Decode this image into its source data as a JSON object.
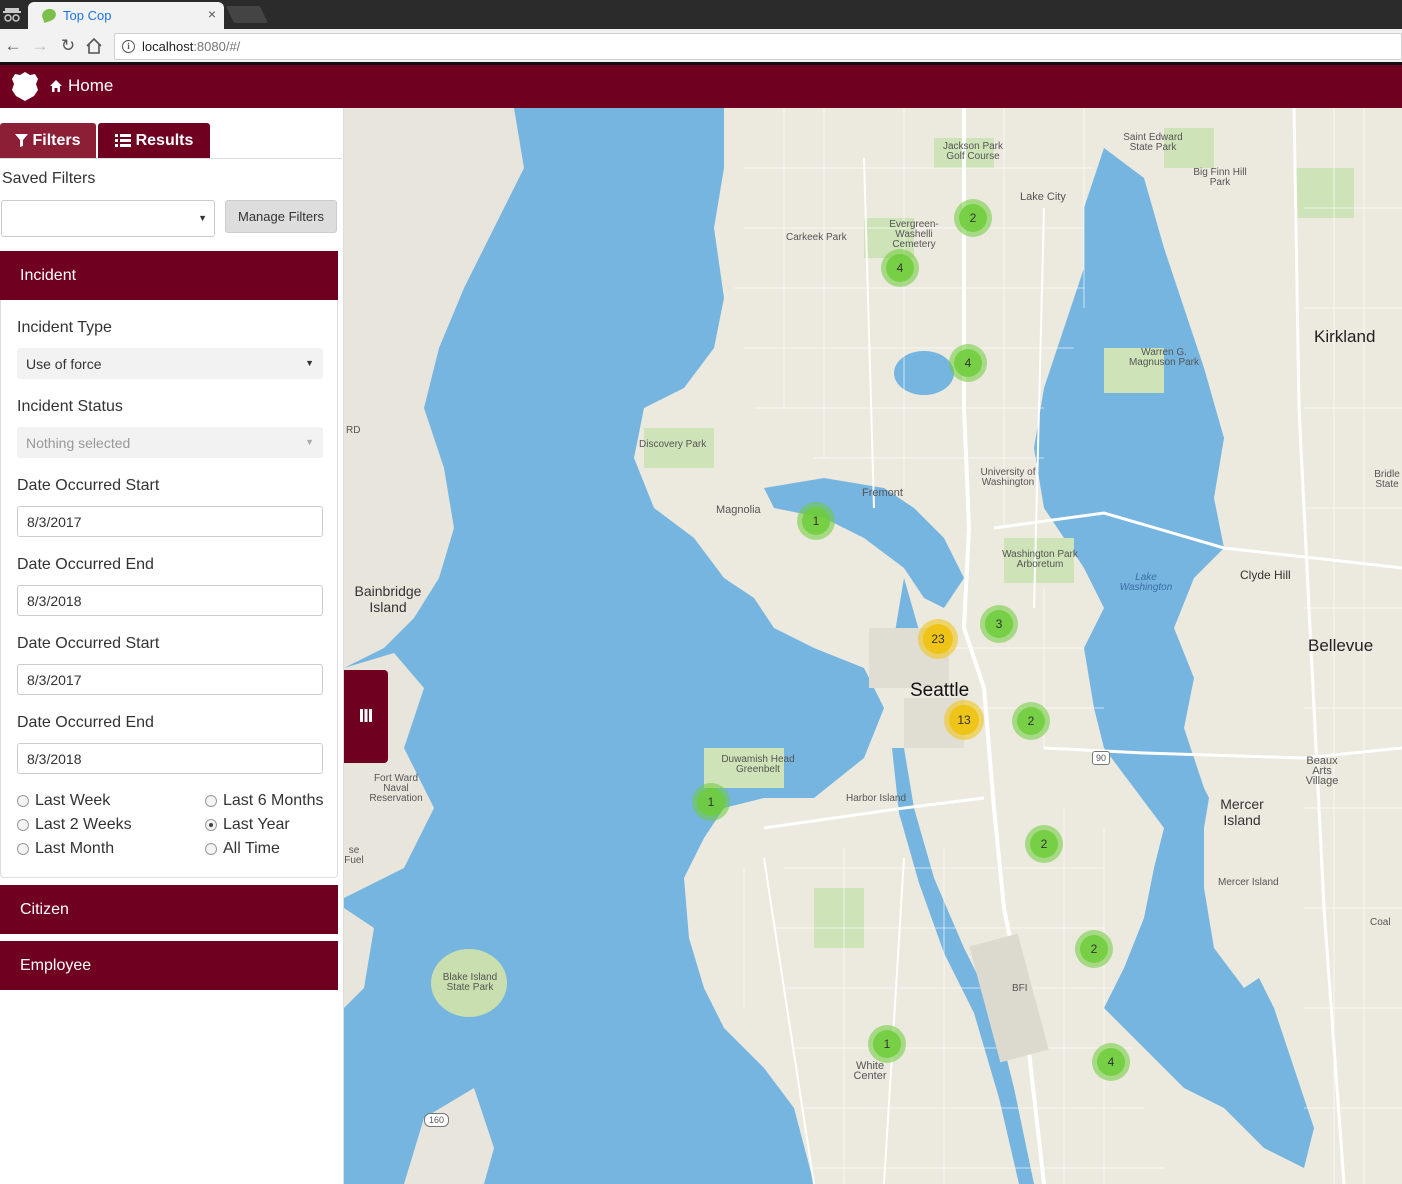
{
  "browser": {
    "tab_title": "Top Cop",
    "tab_close": "×",
    "url_host": "localhost",
    "url_rest": ":8080/#/"
  },
  "navbar": {
    "home_label": "Home"
  },
  "sidebar": {
    "tabs": [
      {
        "label": "Filters"
      },
      {
        "label": "Results"
      }
    ],
    "saved_filters_label": "Saved Filters",
    "saved_filters_value": "",
    "manage_filters_label": "Manage Filters",
    "sections": {
      "incident": "Incident",
      "citizen": "Citizen",
      "employee": "Employee"
    },
    "incident": {
      "type_label": "Incident Type",
      "type_value": "Use of force",
      "status_label": "Incident Status",
      "status_placeholder": "Nothing selected",
      "dates": [
        {
          "label": "Date Occurred Start",
          "value": "8/3/2017"
        },
        {
          "label": "Date Occurred End",
          "value": "8/3/2018"
        },
        {
          "label": "Date Occurred Start",
          "value": "8/3/2017"
        },
        {
          "label": "Date Occurred End",
          "value": "8/3/2018"
        }
      ],
      "ranges": [
        {
          "label": "Last Week",
          "checked": false
        },
        {
          "label": "Last 2 Weeks",
          "checked": false
        },
        {
          "label": "Last Month",
          "checked": false
        },
        {
          "label": "Last 6 Months",
          "checked": false
        },
        {
          "label": "Last Year",
          "checked": true
        },
        {
          "label": "All Time",
          "checked": false
        }
      ]
    }
  },
  "map": {
    "labels": {
      "seattle": "Seattle",
      "bellevue": "Bellevue",
      "kirkland": "Kirkland",
      "bainbridge": "Bainbridge Island",
      "mercer": "Mercer Island",
      "clyde_hill": "Clyde Hill",
      "lake_washington": "Lake Washington",
      "magnolia": "Magnolia",
      "fremont": "Fremont",
      "uw": "University of Washington",
      "discovery": "Discovery Park",
      "carkeek": "Carkeek Park",
      "jackson": "Jackson Park Golf Course",
      "lake_city": "Lake City",
      "saint_edward": "Saint Edward State Park",
      "big_finn": "Big Finn Hill Park",
      "warren": "Warren G. Magnuson Park",
      "arboretum": "Washington Park Arboretum",
      "evergreen": "Evergreen-Washelli Cemetery",
      "harbor": "Harbor Island",
      "duwamish": "Duwamish Head Greenbelt",
      "fort_ward": "Fort Ward Naval Reservation",
      "blake": "Blake Island State Park",
      "white_center": "White Center",
      "bfi": "BFI",
      "beaux": "Beaux Arts Village",
      "bridle": "Bridle State",
      "mercer_park": "Mercer Island",
      "coal": "Coal",
      "fuel": "se Fuel",
      "rd": "RD",
      "hwy90": "90",
      "hwy160": "160"
    },
    "clusters": [
      {
        "count": "2"
      },
      {
        "count": "4"
      },
      {
        "count": "4"
      },
      {
        "count": "1"
      },
      {
        "count": "3"
      },
      {
        "count": "23"
      },
      {
        "count": "13"
      },
      {
        "count": "2"
      },
      {
        "count": "1"
      },
      {
        "count": "2"
      },
      {
        "count": "2"
      },
      {
        "count": "1"
      },
      {
        "count": "4"
      }
    ]
  }
}
